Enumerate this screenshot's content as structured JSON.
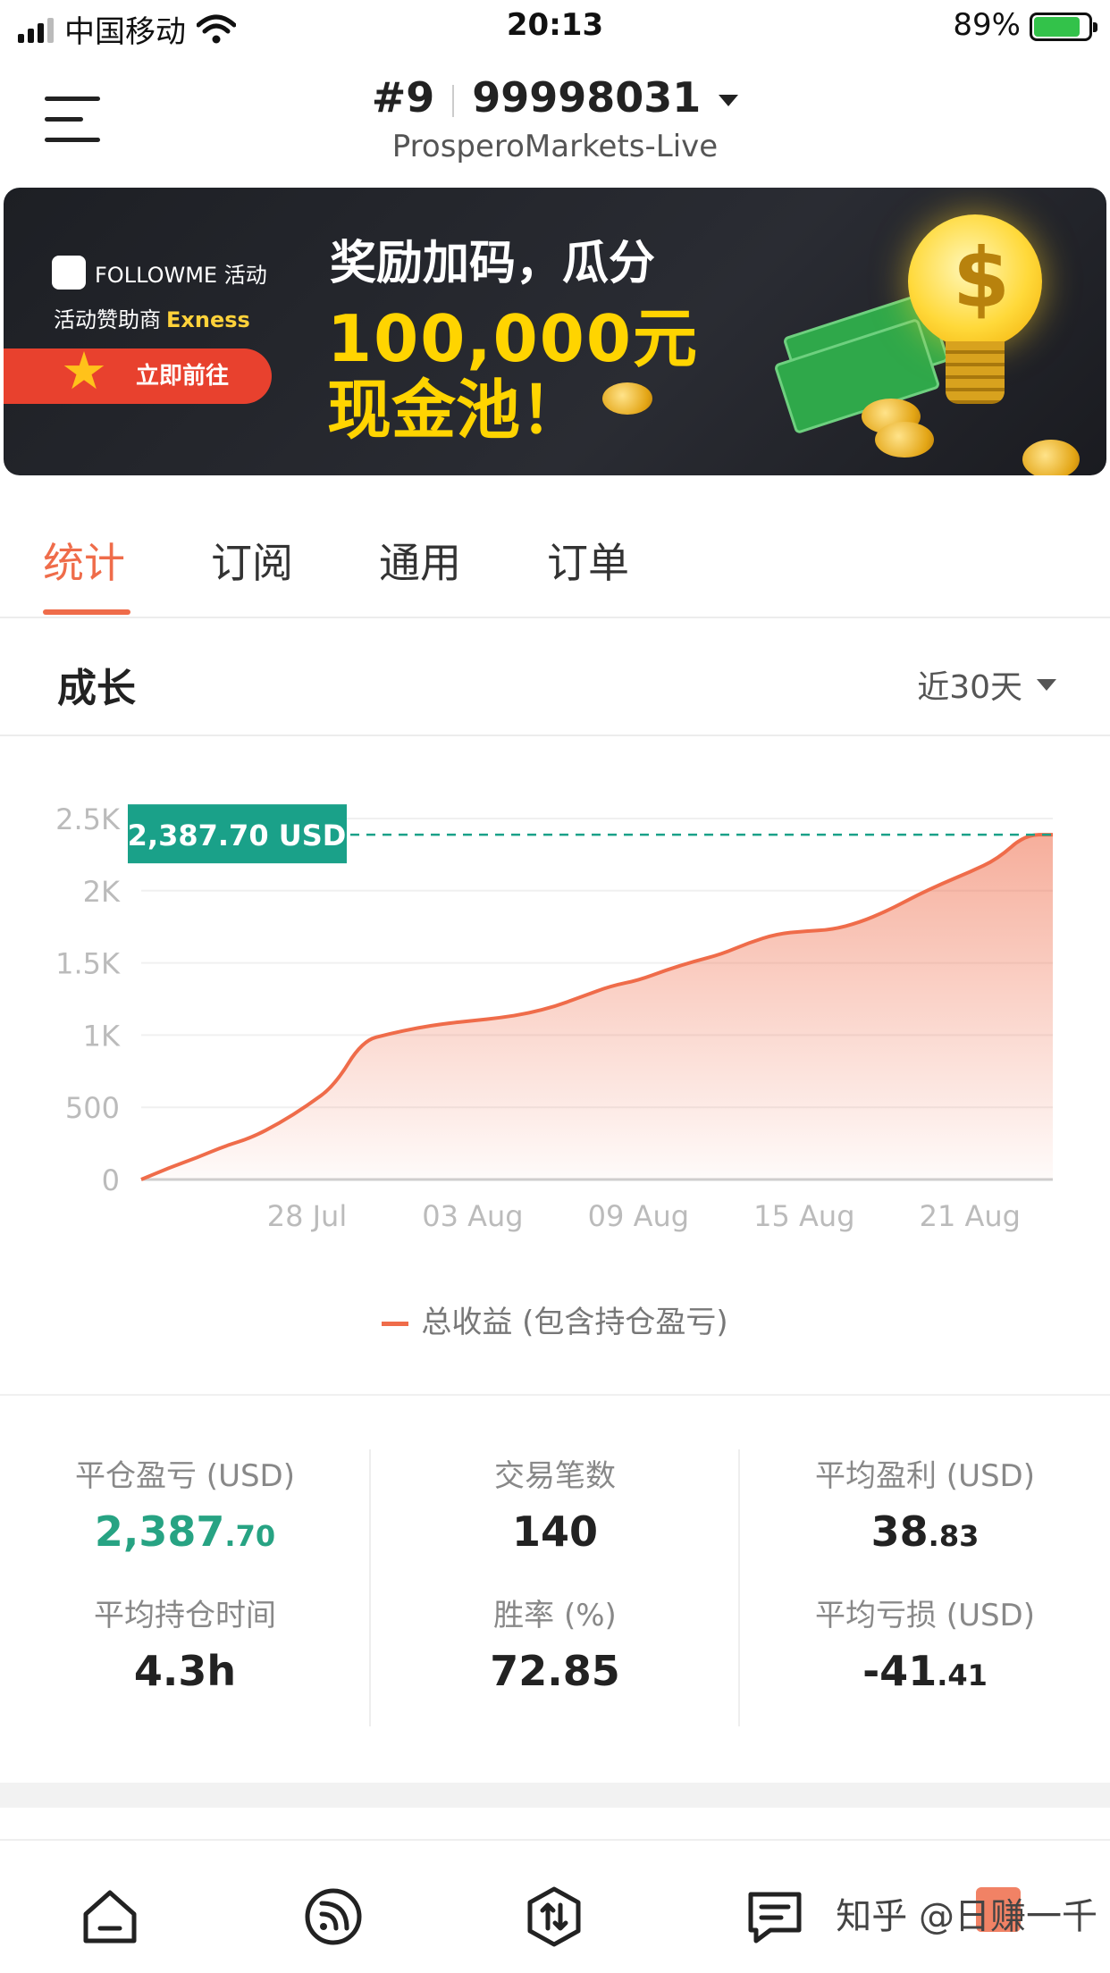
{
  "status_bar": {
    "carrier": "中国移动",
    "time": "20:13",
    "battery": "89%"
  },
  "header": {
    "account_rank": "#9",
    "account_number": "99998031",
    "server": "ProsperoMarkets-Live"
  },
  "banner": {
    "brand": "FOLLOWME 活动",
    "sponsor_prefix": "活动赞助商",
    "sponsor_name": "Exness",
    "cta": "立即前往",
    "line1": "奖励加码，瓜分",
    "line2": "100,000元",
    "line3": "现金池！"
  },
  "tabs": [
    {
      "label": "统计",
      "active": true
    },
    {
      "label": "订阅",
      "active": false
    },
    {
      "label": "通用",
      "active": false
    },
    {
      "label": "订单",
      "active": false
    }
  ],
  "growth": {
    "title": "成长",
    "range": "近30天"
  },
  "chart_data": {
    "type": "area",
    "ylim": [
      0,
      2500
    ],
    "y_ticks": [
      "0",
      "500",
      "1K",
      "1.5K",
      "2K",
      "2.5K"
    ],
    "x_ticks": [
      "28 Jul",
      "03 Aug",
      "09 Aug",
      "15 Aug",
      "21 Aug"
    ],
    "x_tick_days": [
      6,
      12,
      18,
      24,
      30
    ],
    "x_range_days": [
      0,
      33
    ],
    "current_label": "2,387.70 USD",
    "current_value": 2387.7,
    "series": [
      {
        "name": "总收益 (包含持仓盈亏)",
        "color": "#ef6c4a",
        "x": [
          0,
          1,
          2,
          3,
          4,
          5,
          6,
          7,
          8,
          9,
          10,
          11,
          12,
          13,
          14,
          15,
          16,
          17,
          18,
          19,
          20,
          21,
          22,
          23,
          24,
          25,
          26,
          27,
          28,
          29,
          30,
          31,
          32,
          33
        ],
        "values": [
          0,
          80,
          150,
          230,
          290,
          390,
          510,
          650,
          960,
          1010,
          1050,
          1080,
          1100,
          1120,
          1150,
          1200,
          1270,
          1340,
          1380,
          1450,
          1510,
          1560,
          1640,
          1700,
          1720,
          1730,
          1780,
          1860,
          1960,
          2050,
          2130,
          2220,
          2387.7,
          2387.7
        ]
      }
    ]
  },
  "stats": {
    "closed_pnl": {
      "label": "平仓盈亏 (USD)",
      "int": "2,387",
      "dec": ".70"
    },
    "trade_count": {
      "label": "交易笔数",
      "value": "140"
    },
    "avg_profit": {
      "label": "平均盈利 (USD)",
      "int": "38",
      "dec": ".83"
    },
    "avg_hold": {
      "label": "平均持仓时间",
      "value": "4.3h"
    },
    "win_rate": {
      "label": "胜率 (%)",
      "value": "72.85"
    },
    "avg_loss": {
      "label": "平均亏损 (USD)",
      "int": "-41",
      "dec": ".41"
    }
  },
  "watermark": "知乎 @日赚一千",
  "colors": {
    "accent": "#ef6c4a",
    "green": "#27a383",
    "teal_tag": "#1aa189"
  }
}
